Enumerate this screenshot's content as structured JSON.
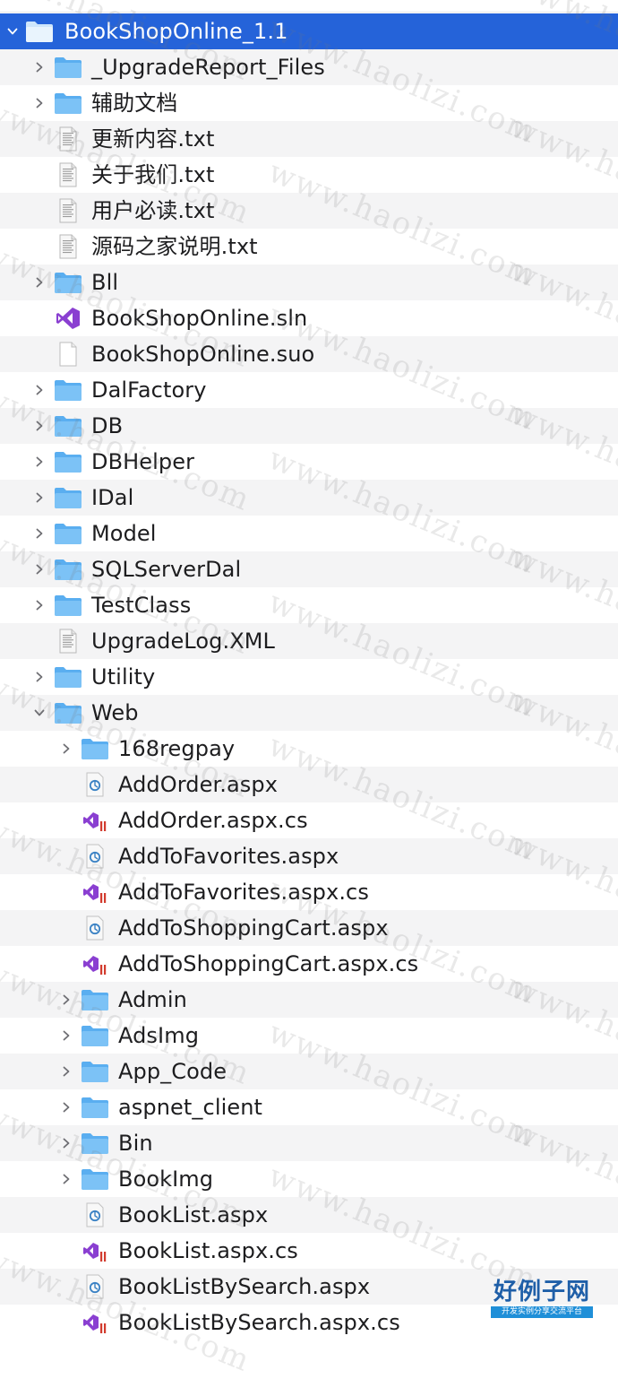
{
  "tree": [
    {
      "label": "BookShopOnline_1.1",
      "type": "folder",
      "depth": 0,
      "expanded": true,
      "selected": true
    },
    {
      "label": "_UpgradeReport_Files",
      "type": "folder",
      "depth": 1
    },
    {
      "label": "辅助文档",
      "type": "folder",
      "depth": 1
    },
    {
      "label": "更新内容.txt",
      "type": "txt",
      "depth": 1
    },
    {
      "label": "关于我们.txt",
      "type": "txt",
      "depth": 1
    },
    {
      "label": "用户必读.txt",
      "type": "txt",
      "depth": 1
    },
    {
      "label": "源码之家说明.txt",
      "type": "txt",
      "depth": 1
    },
    {
      "label": "Bll",
      "type": "folder",
      "depth": 1
    },
    {
      "label": "BookShopOnline.sln",
      "type": "sln",
      "depth": 1
    },
    {
      "label": "BookShopOnline.suo",
      "type": "blank",
      "depth": 1
    },
    {
      "label": "DalFactory",
      "type": "folder",
      "depth": 1
    },
    {
      "label": "DB",
      "type": "folder",
      "depth": 1
    },
    {
      "label": "DBHelper",
      "type": "folder",
      "depth": 1
    },
    {
      "label": "IDal",
      "type": "folder",
      "depth": 1
    },
    {
      "label": "Model",
      "type": "folder",
      "depth": 1
    },
    {
      "label": "SQLServerDal",
      "type": "folder",
      "depth": 1
    },
    {
      "label": "TestClass",
      "type": "folder",
      "depth": 1
    },
    {
      "label": "UpgradeLog.XML",
      "type": "txt",
      "depth": 1
    },
    {
      "label": "Utility",
      "type": "folder",
      "depth": 1
    },
    {
      "label": "Web",
      "type": "folder",
      "depth": 1,
      "expanded": true
    },
    {
      "label": "168regpay",
      "type": "folder",
      "depth": 2
    },
    {
      "label": "AddOrder.aspx",
      "type": "aspx",
      "depth": 2
    },
    {
      "label": "AddOrder.aspx.cs",
      "type": "cs",
      "depth": 2
    },
    {
      "label": "AddToFavorites.aspx",
      "type": "aspx",
      "depth": 2
    },
    {
      "label": "AddToFavorites.aspx.cs",
      "type": "cs",
      "depth": 2
    },
    {
      "label": "AddToShoppingCart.aspx",
      "type": "aspx",
      "depth": 2
    },
    {
      "label": "AddToShoppingCart.aspx.cs",
      "type": "cs",
      "depth": 2
    },
    {
      "label": "Admin",
      "type": "folder",
      "depth": 2
    },
    {
      "label": "AdsImg",
      "type": "folder",
      "depth": 2
    },
    {
      "label": "App_Code",
      "type": "folder",
      "depth": 2
    },
    {
      "label": "aspnet_client",
      "type": "folder",
      "depth": 2
    },
    {
      "label": "Bin",
      "type": "folder",
      "depth": 2
    },
    {
      "label": "BookImg",
      "type": "folder",
      "depth": 2
    },
    {
      "label": "BookList.aspx",
      "type": "aspx",
      "depth": 2
    },
    {
      "label": "BookList.aspx.cs",
      "type": "cs",
      "depth": 2
    },
    {
      "label": "BookListBySearch.aspx",
      "type": "aspx",
      "depth": 2
    },
    {
      "label": "BookListBySearch.aspx.cs",
      "type": "cs",
      "depth": 2
    }
  ],
  "icons": {
    "folder": "folder-icon",
    "txt": "text-document-icon",
    "sln": "visual-studio-solution-icon",
    "blank": "blank-document-icon",
    "aspx": "aspx-page-icon",
    "cs": "csharp-file-icon"
  },
  "colors": {
    "selection": "#2563d9",
    "folder": "#5aaef0",
    "folder_dark": "#3e93dd",
    "vs_purple": "#8a3fd1",
    "cs_red": "#d23b2e",
    "stripe": "#f4f4f5"
  },
  "watermark": {
    "text": "www.haolizi.com"
  },
  "logo": {
    "big": "好例子网",
    "small": "开发实例分享交流平台"
  }
}
